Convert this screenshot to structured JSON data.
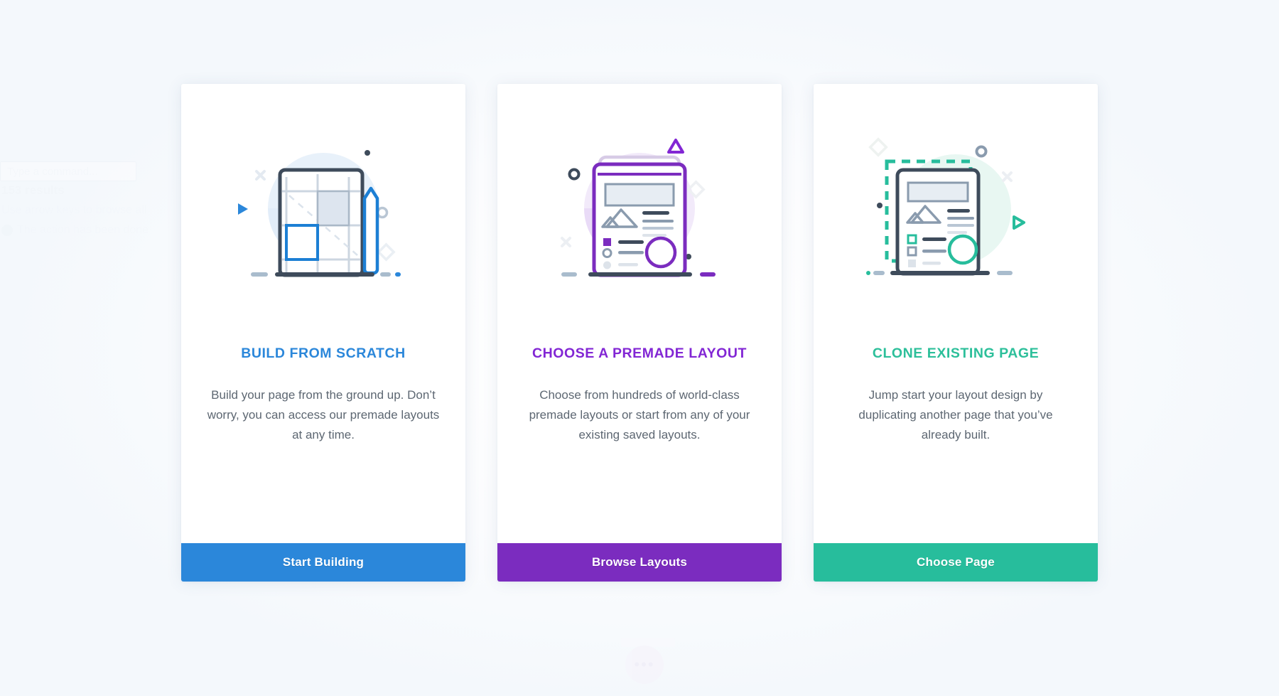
{
  "background_ghost": {
    "search_placeholder": "Type a command...",
    "results_count": "153 results",
    "hint": "Use arrow keys to browse all",
    "toast": "The action has been done",
    "fab_label": "•••"
  },
  "colors": {
    "blue": "#2b87da",
    "purple": "#7b2cbf",
    "purple_text": "#8226d4",
    "teal": "#27bd9c",
    "teal_text": "#2cbf9a",
    "dark_outline": "#3e4b5b",
    "slate": "#8a9bae",
    "page_bg": "#ffffff",
    "card_bg": "#ffffff",
    "body_text": "#5d6772"
  },
  "cards": [
    {
      "id": "build-from-scratch",
      "illustration": "blueprint-grid-with-pencil-and-wrench",
      "title": "BUILD FROM SCRATCH",
      "description": "Build your page from the ground up. Don’t worry, you can access our premade layouts at any time.",
      "button_label": "Start Building",
      "accent": "#2b87da",
      "button_color": "#2b87da"
    },
    {
      "id": "choose-a-premade-layout",
      "illustration": "stacked-layout-pages",
      "title": "CHOOSE A PREMADE LAYOUT",
      "description": "Choose from hundreds of world-class premade layouts or start from any of your existing saved layouts.",
      "button_label": "Browse Layouts",
      "accent": "#8226d4",
      "button_color": "#7b2cbf"
    },
    {
      "id": "clone-existing-page",
      "illustration": "page-with-dashed-selection",
      "title": "CLONE EXISTING PAGE",
      "description": "Jump start your layout design by duplicating another page that you’ve already built.",
      "button_label": "Choose Page",
      "accent": "#2cbf9a",
      "button_color": "#27bd9c"
    }
  ]
}
